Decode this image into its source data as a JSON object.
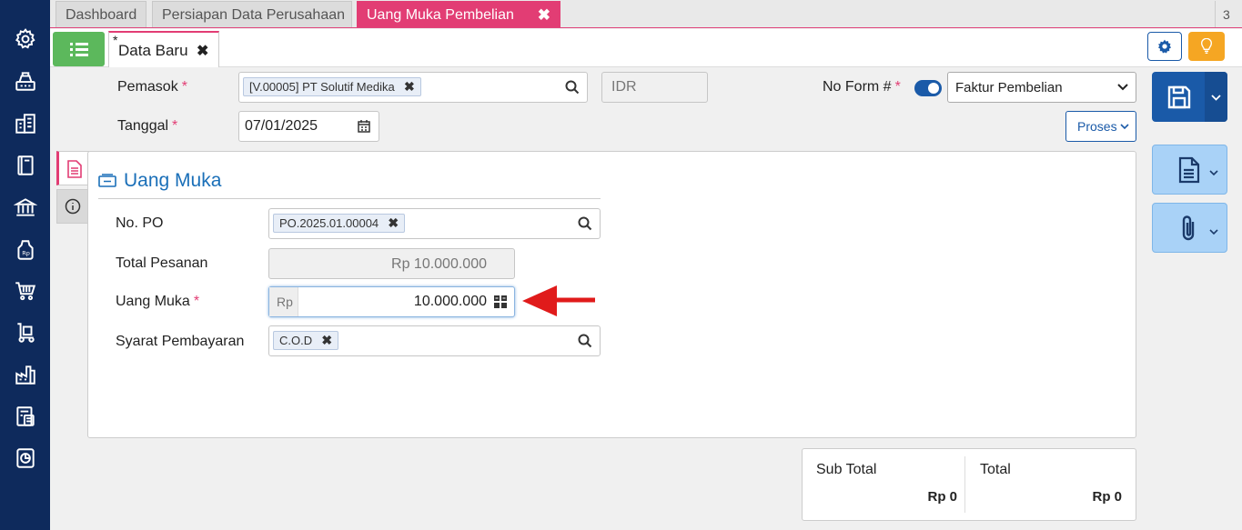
{
  "tabs": [
    {
      "label": "Dashboard"
    },
    {
      "label": "Persiapan Data Perusahaan"
    },
    {
      "label": "Uang Muka Pembelian"
    }
  ],
  "tab_count": "3",
  "doc_tab": {
    "modified_mark": "*",
    "label": "Data Baru"
  },
  "header": {
    "pemasok_label": "Pemasok",
    "pemasok_value": "[V.00005] PT Solutif Medika",
    "currency": "IDR",
    "tanggal_label": "Tanggal",
    "tanggal_value": "07/01/2025",
    "noform_label": "No Form #",
    "form_type": "Faktur Pembelian",
    "proses_label": "Proses"
  },
  "required_mark": "*",
  "section": {
    "title": "Uang Muka",
    "no_po_label": "No. PO",
    "no_po_value": "PO.2025.01.00004",
    "total_pesanan_label": "Total Pesanan",
    "total_pesanan_value": "Rp 10.000.000",
    "uang_muka_label": "Uang Muka",
    "uang_muka_prefix": "Rp",
    "uang_muka_value": "10.000.000",
    "syarat_label": "Syarat Pembayaran",
    "syarat_value": "C.O.D"
  },
  "totals": {
    "sub_total_label": "Sub Total",
    "sub_total_value": "Rp 0",
    "total_label": "Total",
    "total_value": "Rp 0"
  },
  "colors": {
    "accent": "#e23d74",
    "primary": "#1a5aa8",
    "sidebar": "#0e2a5c",
    "arrow": "#e01b1b"
  }
}
